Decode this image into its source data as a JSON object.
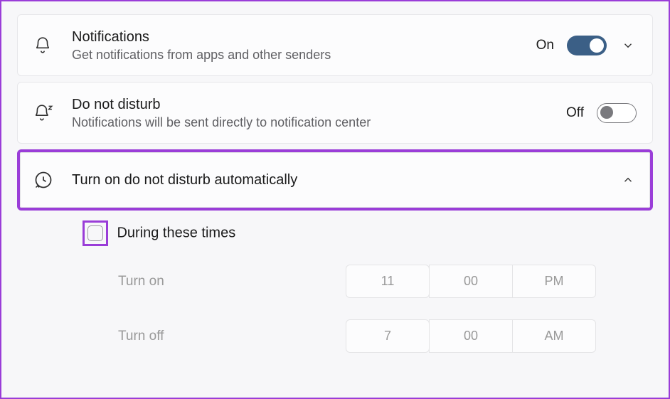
{
  "notifications": {
    "title": "Notifications",
    "subtitle": "Get notifications from apps and other senders",
    "state": "On"
  },
  "dnd": {
    "title": "Do not disturb",
    "subtitle": "Notifications will be sent directly to notification center",
    "state": "Off"
  },
  "auto": {
    "title": "Turn on do not disturb automatically"
  },
  "schedule": {
    "during_label": "During these times",
    "turn_on_label": "Turn on",
    "turn_off_label": "Turn off",
    "on": {
      "hour": "11",
      "minute": "00",
      "ampm": "PM"
    },
    "off": {
      "hour": "7",
      "minute": "00",
      "ampm": "AM"
    }
  }
}
